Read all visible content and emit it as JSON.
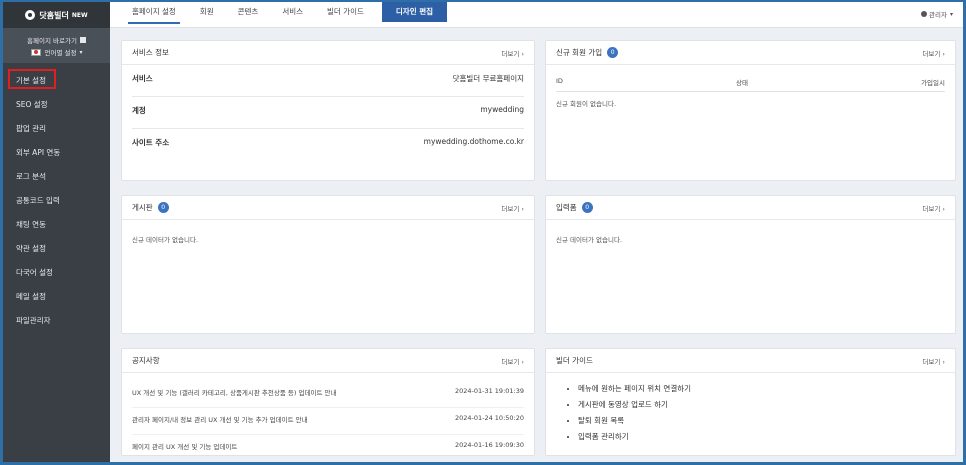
{
  "app": {
    "logo_text": "닷홈빌더",
    "logo_badge": "NEW"
  },
  "sidebar": {
    "homepage_shortcut": "홈페이지 바로가기",
    "language_setting": "언어별 설정",
    "items": [
      {
        "label": "기본 설정"
      },
      {
        "label": "SEO 설정"
      },
      {
        "label": "팝업 관리"
      },
      {
        "label": "외부 API 연동"
      },
      {
        "label": "로그 분석"
      },
      {
        "label": "공통코드 입력"
      },
      {
        "label": "채팅 연동"
      },
      {
        "label": "약관 설정"
      },
      {
        "label": "다국어 설정"
      },
      {
        "label": "메일 설정"
      },
      {
        "label": "파일관리자"
      }
    ]
  },
  "topbar": {
    "tabs": [
      "홈페이지 설정",
      "회원",
      "콘텐츠",
      "서비스",
      "빌더 가이드"
    ],
    "design_button": "디자인 편집",
    "user": "관리자"
  },
  "panels": {
    "more_label": "더보기",
    "service_info": {
      "title": "서비스 정보",
      "rows": [
        {
          "k": "서비스",
          "v": "닷홈빌더 무료홈페이지"
        },
        {
          "k": "계정",
          "v": "mywedding"
        },
        {
          "k": "사이트 주소",
          "v": "mywedding.dothome.co.kr"
        }
      ]
    },
    "new_members": {
      "title": "신규 회원 가입",
      "count": "0",
      "cols": [
        "ID",
        "상태",
        "가입일시"
      ],
      "empty": "신규 회원이 없습니다."
    },
    "board": {
      "title": "게시판",
      "count": "0",
      "empty": "신규 데이터가 없습니다."
    },
    "inputs": {
      "title": "입력폼",
      "count": "0",
      "empty": "신규 데이터가 없습니다."
    },
    "notice": {
      "title": "공지사항",
      "rows": [
        {
          "text": "UX 개선 및 기능 (갤러리 카테고리, 상품게시판 추천상품 등) 업데이트 안내",
          "date": "2024-01-31 19:01:39"
        },
        {
          "text": "관리자 페이지/내 정보 관리 UX 개선 및 기능 추가 업데이트 안내",
          "date": "2024-01-24 10:50:20"
        },
        {
          "text": "페이지 관리 UX 개선 및 기능 업데이트",
          "date": "2024-01-16 19:09:30"
        }
      ]
    },
    "guide": {
      "title": "빌더 가이드",
      "items": [
        "메뉴에 원하는 페이지 위치 연결하기",
        "게시판에 동영상 업로드 하기",
        "탈퇴 회원 목록",
        "입력폼 관리하기"
      ]
    }
  }
}
